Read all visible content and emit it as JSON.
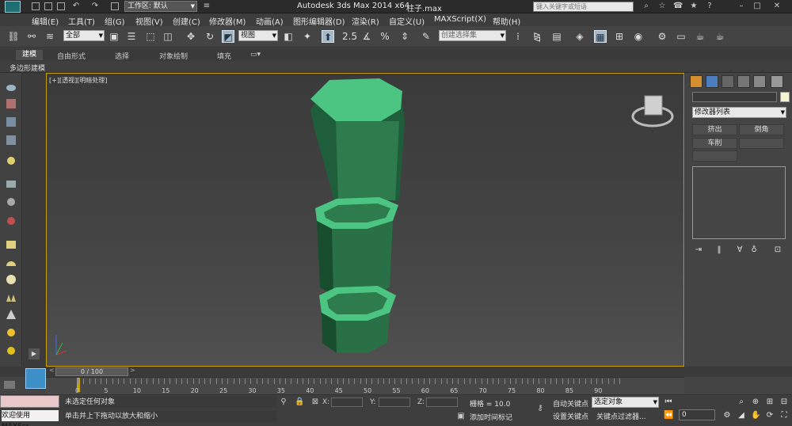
{
  "titlebar": {
    "app_title": "Autodesk 3ds Max  2014 x64",
    "file_name": "柱子.max",
    "workspace": "工作区: 默认",
    "search_placeholder": "键入关键字或短语"
  },
  "menu": {
    "items": [
      "编辑(E)",
      "工具(T)",
      "组(G)",
      "视图(V)",
      "创建(C)",
      "修改器(M)",
      "动画(A)",
      "图形编辑器(D)",
      "渲染(R)",
      "自定义(U)",
      "MAXScript(X)",
      "帮助(H)"
    ]
  },
  "toolbar": {
    "selection_filter": "全部",
    "reference_coord": "视图",
    "snap_angle_label": "2.5",
    "percent_snap_label": "%",
    "named_selection_placeholder": "创建选择集"
  },
  "ribbon": {
    "tabs": [
      "建模",
      "自由形式",
      "选择",
      "对象绘制",
      "填充"
    ],
    "active_tab": "建模",
    "sub_label": "多边形建模"
  },
  "viewport": {
    "label": "[+][透视][明暗处理]"
  },
  "command_panel": {
    "modifier_list": "修改器列表",
    "buttons": [
      "挤出",
      "倒角",
      "车削"
    ]
  },
  "timeline": {
    "slider_label": "0 / 100",
    "ticks": [
      "0",
      "5",
      "10",
      "15",
      "20",
      "25",
      "30",
      "35",
      "40",
      "45",
      "50",
      "55",
      "60",
      "65",
      "70",
      "75",
      "80",
      "85",
      "90"
    ]
  },
  "status": {
    "maxscript_label": "欢迎使用 MAXScr",
    "line1": "未选定任何对象",
    "line2": "单击并上下拖动以放大和缩小",
    "x_label": "X:",
    "y_label": "Y:",
    "z_label": "Z:",
    "grid": "栅格 = 10.0",
    "add_time_tag": "添加时间标记",
    "auto_key": "自动关键点",
    "set_key": "设置关键点",
    "selected_dd": "选定对象",
    "key_filters": "关键点过滤器...",
    "frame": "0"
  },
  "colors": {
    "object_green": "#2f8a55",
    "viewport_border": "#c9a100",
    "active_blue": "#3d8fc7"
  }
}
